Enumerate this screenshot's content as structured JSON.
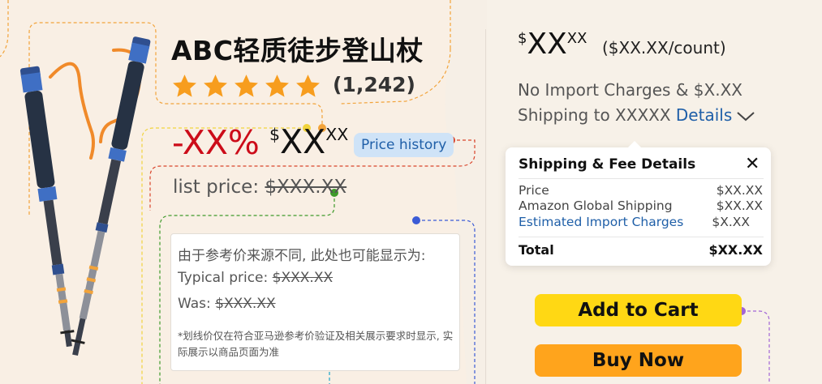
{
  "product": {
    "title": "ABC轻质徒步登山杖",
    "rating_stars": 5,
    "rating_count": "(1,242)"
  },
  "pricing": {
    "discount": "-XX%",
    "currency_symbol": "$",
    "price_whole": "XX",
    "price_fraction": "XX",
    "price_history_label": "Price history",
    "list_price_label": "list price:",
    "list_price_value": "$XXX.XX"
  },
  "reference_box": {
    "intro": "由于参考价来源不同, 此处也可能显示为:",
    "typical_label": "Typical price:",
    "typical_value": "$XXX.XX",
    "was_label": "Was:",
    "was_value": "$XXX.XX",
    "note": "*划线价仅在符合亚马逊参考价验证及相关展示要求时显示, 实际展示以商品页面为准"
  },
  "buy_box": {
    "currency_symbol": "$",
    "price_whole": "XX",
    "price_fraction": "XX",
    "per_count": "($XX.XX/count)",
    "import_line1": "No Import Charges & $X.XX",
    "import_line2_prefix": "Shipping to XXXXX",
    "details_link": "Details"
  },
  "fee_popover": {
    "title": "Shipping & Fee Details",
    "close": "✕",
    "rows": [
      {
        "label": "Price",
        "value": "$XX.XX"
      },
      {
        "label": "Amazon Global Shipping",
        "value": "$XX.XX"
      },
      {
        "label": "Estimated Import Charges",
        "value": "$X.XX"
      }
    ],
    "total_label": "Total",
    "total_value": "$XX.XX"
  },
  "actions": {
    "add_to_cart": "Add to Cart",
    "buy_now": "Buy Now"
  },
  "colors": {
    "background": "#f6efe6",
    "star": "#f79d1e",
    "discount": "#cc0c19",
    "link": "#1f5fa8",
    "price_history_bg": "#cfe3f7",
    "add_to_cart": "#ffd814",
    "buy_now": "#ffa41c",
    "annotation_orange": "#f2a33a",
    "annotation_yellow": "#f1d33c",
    "annotation_red": "#d9442b",
    "annotation_green": "#3e9a2a",
    "annotation_blue": "#3b5bd6",
    "annotation_cyan": "#1aa4c9",
    "annotation_purple": "#a366d6"
  },
  "icons": {
    "product_image": "trekking-poles-image",
    "star": "star-icon",
    "chevron": "chevron-down-icon",
    "close": "close-icon"
  }
}
